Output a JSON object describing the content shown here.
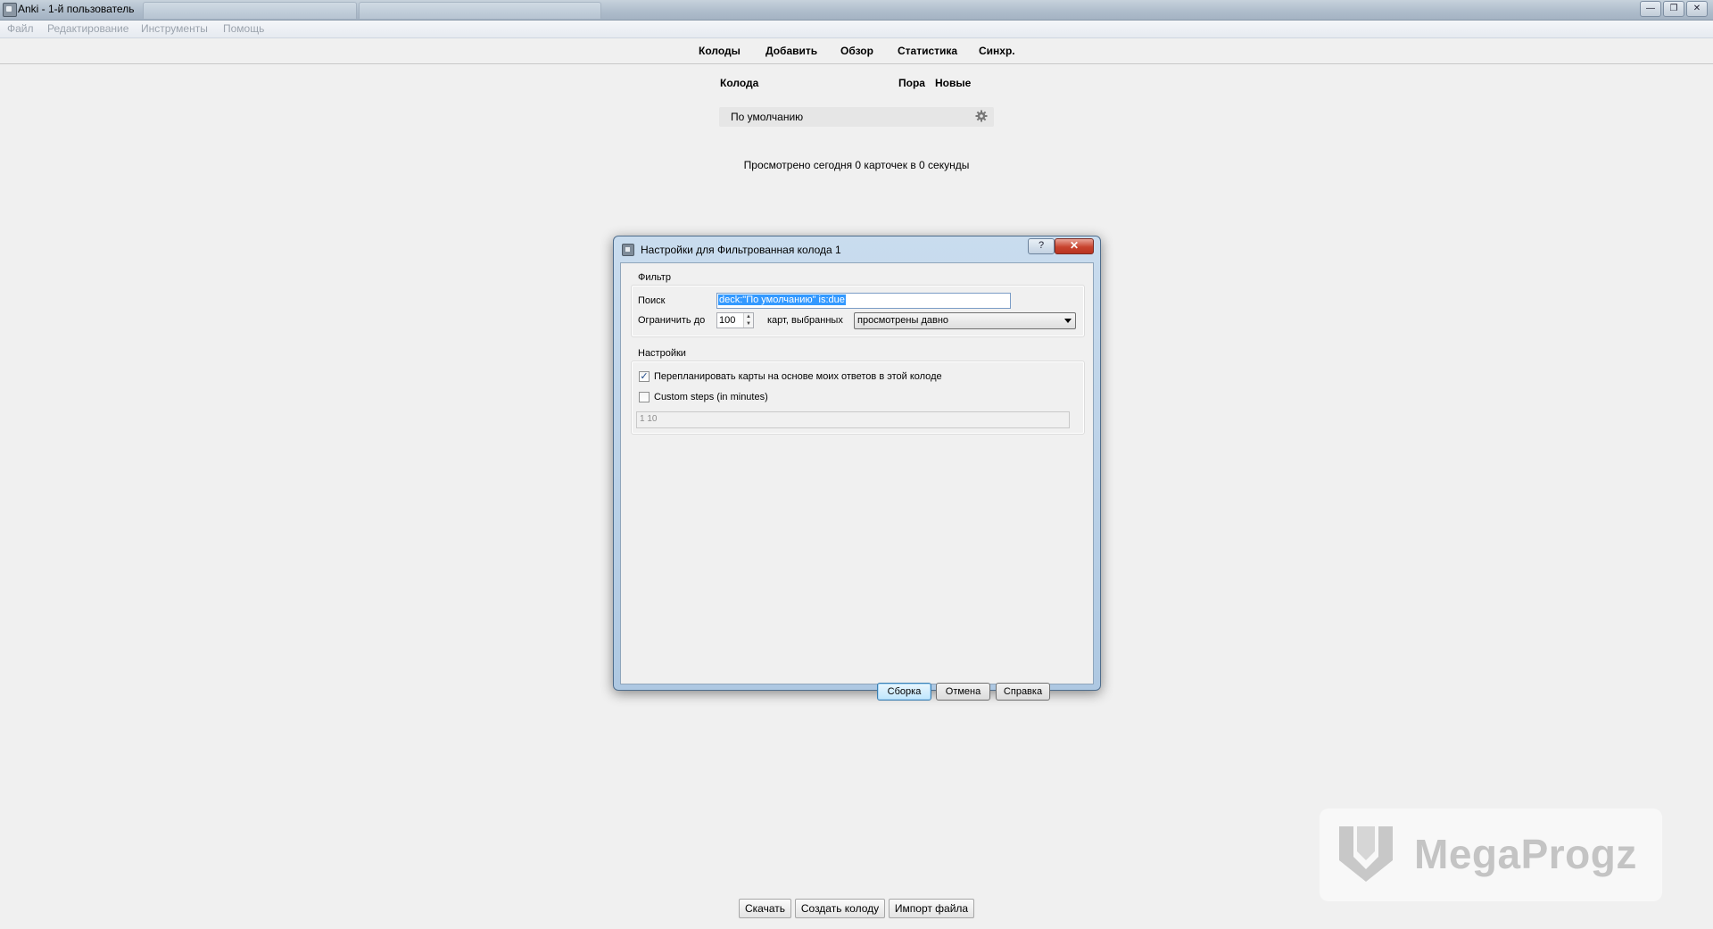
{
  "window": {
    "title": "Anki - 1-й пользователь"
  },
  "menubar": {
    "items": [
      "Файл",
      "Редактирование",
      "Инструменты",
      "Помощь"
    ]
  },
  "toolbar": {
    "decks": "Колоды",
    "add": "Добавить",
    "browse": "Обзор",
    "stats": "Статистика",
    "sync": "Синхр."
  },
  "deck_list": {
    "col_deck": "Колода",
    "col_due": "Пора",
    "col_new": "Новые",
    "decks": [
      {
        "name": "По умолчанию"
      }
    ],
    "studied_today": "Просмотрено сегодня 0 карточек в 0 секунды"
  },
  "bottom_buttons": {
    "download": "Скачать",
    "create_deck": "Создать колоду",
    "import": "Импорт файла"
  },
  "watermark": {
    "text": "MegaProgz"
  },
  "dialog": {
    "title": "Настройки для Фильтрованная колода 1",
    "help_glyph": "?",
    "close_glyph": "✕",
    "filter_group": "Фильтр",
    "search_label": "Поиск",
    "search_value": "deck:\"По умолчанию\" is:due",
    "limit_label": "Ограничить до",
    "limit_value": "100",
    "cards_selected_label": "карт, выбранных",
    "order_value": "просмотрены давно",
    "options_group": "Настройки",
    "reschedule_label": "Перепланировать карты на основе моих ответов в этой колоде",
    "reschedule_checked": true,
    "custom_steps_label": "Custom steps (in minutes)",
    "custom_steps_checked": false,
    "steps_value": "1 10",
    "build_button": "Сборка",
    "cancel_button": "Отмена",
    "help_button": "Справка"
  }
}
